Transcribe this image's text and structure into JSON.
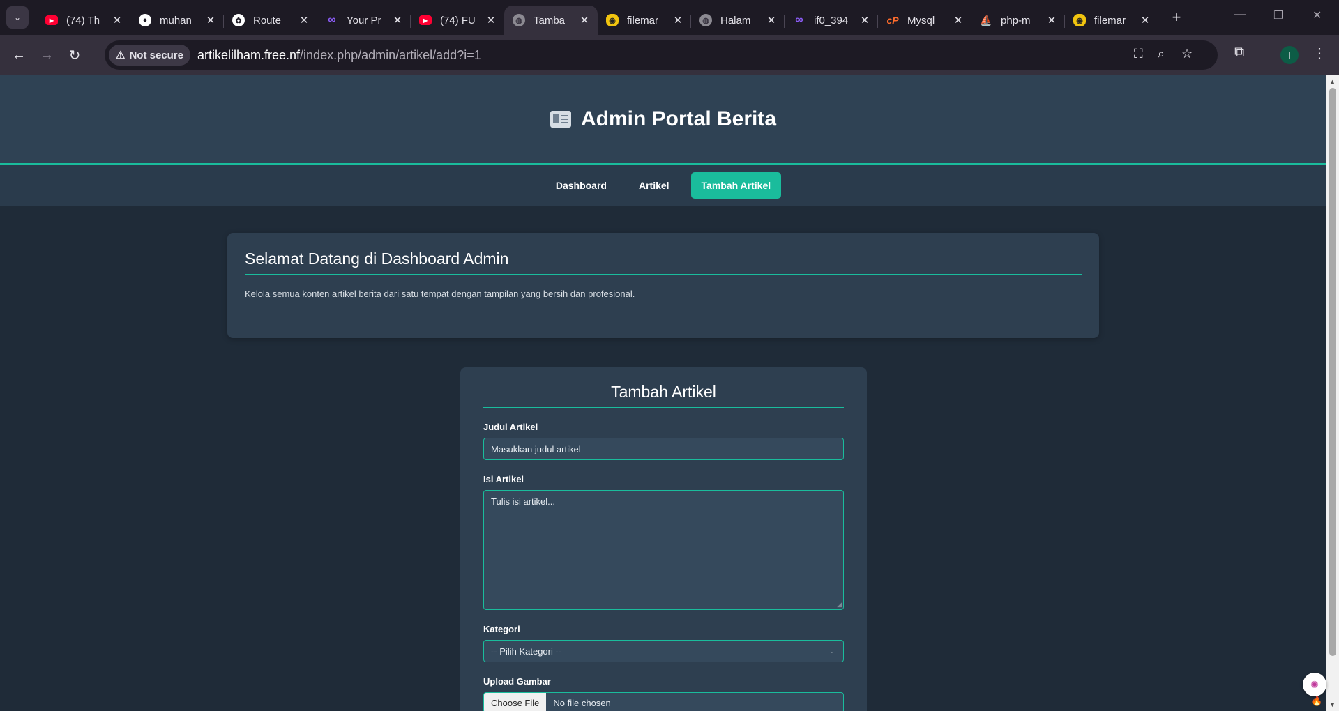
{
  "browser": {
    "tabs": [
      {
        "title": "(74) Th",
        "icon": "youtube-icon"
      },
      {
        "title": "muhan",
        "icon": "github-icon"
      },
      {
        "title": "Route",
        "icon": "openai-icon"
      },
      {
        "title": "Your Pr",
        "icon": "infinity-icon"
      },
      {
        "title": "(74) FU",
        "icon": "youtube-icon"
      },
      {
        "title": "Tamba",
        "icon": "globe-icon",
        "active": true
      },
      {
        "title": "filemar",
        "icon": "filemanager-icon"
      },
      {
        "title": "Halam",
        "icon": "globe-icon"
      },
      {
        "title": "if0_394",
        "icon": "infinity-icon"
      },
      {
        "title": "Mysql",
        "icon": "cpanel-icon"
      },
      {
        "title": "php-m",
        "icon": "phpmyadmin-icon"
      },
      {
        "title": "filemar",
        "icon": "filemanager-icon"
      }
    ],
    "security_label": "Not secure",
    "url_host": "artikelilham.free.nf",
    "url_path": "/index.php/admin/artikel/add?i=1",
    "profile_initial": "I"
  },
  "page": {
    "header_title": "Admin Portal Berita",
    "nav": [
      {
        "label": "Dashboard",
        "active": false
      },
      {
        "label": "Artikel",
        "active": false
      },
      {
        "label": "Tambah Artikel",
        "active": true
      }
    ],
    "welcome": {
      "title": "Selamat Datang di Dashboard Admin",
      "text": "Kelola semua konten artikel berita dari satu tempat dengan tampilan yang bersih dan profesional."
    },
    "form": {
      "title": "Tambah Artikel",
      "judul_label": "Judul Artikel",
      "judul_placeholder": "Masukkan judul artikel",
      "isi_label": "Isi Artikel",
      "isi_placeholder": "Tulis isi artikel...",
      "kategori_label": "Kategori",
      "kategori_selected": "-- Pilih Kategori --",
      "gambar_label": "Upload Gambar",
      "file_button": "Choose File",
      "file_status": "No file chosen"
    }
  },
  "colors": {
    "accent": "#1abc9c",
    "page_bg": "#1f2b38",
    "card_bg": "#2e3f50",
    "header_bg": "#2f4254"
  }
}
